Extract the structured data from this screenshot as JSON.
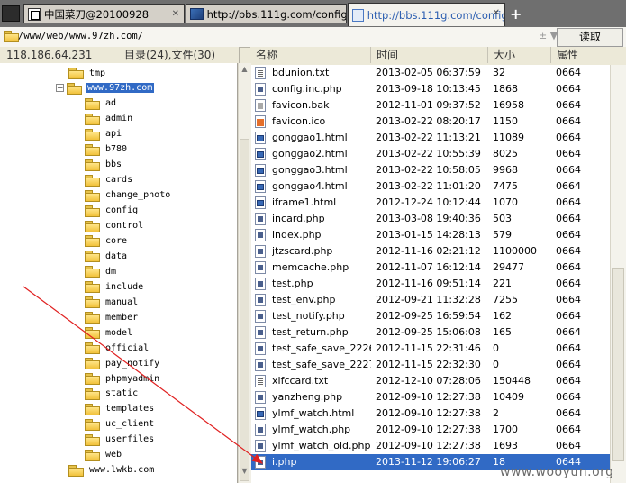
{
  "tabs": [
    {
      "label": "中国菜刀@20100928",
      "icon": "app-window-icon",
      "active": false
    },
    {
      "label": "http://bbs.111g.com/config/...",
      "icon": "image-favicon-icon",
      "active": false
    },
    {
      "label": "http://bbs.111g.com/config/...",
      "icon": "page-favicon-icon",
      "active": true
    }
  ],
  "tab_close_glyph": "✕",
  "new_tab_glyph": "+",
  "path": {
    "value": "/www/web/www.97zh.com/",
    "arrows": "± ▼",
    "button_label": "读取"
  },
  "header": {
    "ip": "118.186.64.231",
    "counts": "目录(24),文件(30)",
    "columns": {
      "name": "名称",
      "time": "时间",
      "size": "大小",
      "attr": "属性"
    }
  },
  "tree": {
    "nodes": [
      {
        "label": "tmp",
        "level": 2
      },
      {
        "label": "www.97zh.com",
        "level": 2,
        "expanded": true,
        "selected": true
      },
      {
        "label": "ad",
        "level": 3
      },
      {
        "label": "admin",
        "level": 3
      },
      {
        "label": "api",
        "level": 3
      },
      {
        "label": "b780",
        "level": 3
      },
      {
        "label": "bbs",
        "level": 3
      },
      {
        "label": "cards",
        "level": 3
      },
      {
        "label": "change_photo",
        "level": 3
      },
      {
        "label": "config",
        "level": 3
      },
      {
        "label": "control",
        "level": 3
      },
      {
        "label": "core",
        "level": 3
      },
      {
        "label": "data",
        "level": 3
      },
      {
        "label": "dm",
        "level": 3
      },
      {
        "label": "include",
        "level": 3
      },
      {
        "label": "manual",
        "level": 3
      },
      {
        "label": "member",
        "level": 3
      },
      {
        "label": "model",
        "level": 3
      },
      {
        "label": "official",
        "level": 3
      },
      {
        "label": "pay_notify",
        "level": 3
      },
      {
        "label": "phpmyadmin",
        "level": 3
      },
      {
        "label": "static",
        "level": 3
      },
      {
        "label": "templates",
        "level": 3
      },
      {
        "label": "uc_client",
        "level": 3
      },
      {
        "label": "userfiles",
        "level": 3
      },
      {
        "label": "web",
        "level": 3
      },
      {
        "label": "www.lwkb.com",
        "level": 2
      }
    ],
    "expander_glyph": "−"
  },
  "files": [
    {
      "name": "bdunion.txt",
      "time": "2013-02-05 06:37:59",
      "size": "32",
      "attr": "0664",
      "type": "txt"
    },
    {
      "name": "config.inc.php",
      "time": "2013-09-18 10:13:45",
      "size": "1868",
      "attr": "0664",
      "type": "php"
    },
    {
      "name": "favicon.bak",
      "time": "2012-11-01 09:37:52",
      "size": "16958",
      "attr": "0664",
      "type": "bak"
    },
    {
      "name": "favicon.ico",
      "time": "2013-02-22 08:20:17",
      "size": "1150",
      "attr": "0664",
      "type": "ico"
    },
    {
      "name": "gonggao1.html",
      "time": "2013-02-22 11:13:21",
      "size": "11089",
      "attr": "0664",
      "type": "html"
    },
    {
      "name": "gonggao2.html",
      "time": "2013-02-22 10:55:39",
      "size": "8025",
      "attr": "0664",
      "type": "html"
    },
    {
      "name": "gonggao3.html",
      "time": "2013-02-22 10:58:05",
      "size": "9968",
      "attr": "0664",
      "type": "html"
    },
    {
      "name": "gonggao4.html",
      "time": "2013-02-22 11:01:20",
      "size": "7475",
      "attr": "0664",
      "type": "html"
    },
    {
      "name": "iframe1.html",
      "time": "2012-12-24 10:12:44",
      "size": "1070",
      "attr": "0664",
      "type": "html"
    },
    {
      "name": "incard.php",
      "time": "2013-03-08 19:40:36",
      "size": "503",
      "attr": "0664",
      "type": "php"
    },
    {
      "name": "index.php",
      "time": "2013-01-15 14:28:13",
      "size": "579",
      "attr": "0664",
      "type": "php"
    },
    {
      "name": "jtzscard.php",
      "time": "2012-11-16 02:21:12",
      "size": "1100000",
      "attr": "0664",
      "type": "php"
    },
    {
      "name": "memcache.php",
      "time": "2012-11-07 16:12:14",
      "size": "29477",
      "attr": "0664",
      "type": "php"
    },
    {
      "name": "test.php",
      "time": "2012-11-16 09:51:14",
      "size": "221",
      "attr": "0664",
      "type": "php"
    },
    {
      "name": "test_env.php",
      "time": "2012-09-21 11:32:28",
      "size": "7255",
      "attr": "0664",
      "type": "php"
    },
    {
      "name": "test_notify.php",
      "time": "2012-09-25 16:59:54",
      "size": "162",
      "attr": "0664",
      "type": "php"
    },
    {
      "name": "test_return.php",
      "time": "2012-09-25 15:06:08",
      "size": "165",
      "attr": "0664",
      "type": "php"
    },
    {
      "name": "test_safe_save_2226...",
      "time": "2012-11-15 22:31:46",
      "size": "0",
      "attr": "0664",
      "type": "php"
    },
    {
      "name": "test_safe_save_2227...",
      "time": "2012-11-15 22:32:30",
      "size": "0",
      "attr": "0664",
      "type": "php"
    },
    {
      "name": "xlfccard.txt",
      "time": "2012-12-10 07:28:06",
      "size": "150448",
      "attr": "0664",
      "type": "txt"
    },
    {
      "name": "yanzheng.php",
      "time": "2012-09-10 12:27:38",
      "size": "10409",
      "attr": "0664",
      "type": "php"
    },
    {
      "name": "ylmf_watch.html",
      "time": "2012-09-10 12:27:38",
      "size": "2",
      "attr": "0664",
      "type": "html"
    },
    {
      "name": "ylmf_watch.php",
      "time": "2012-09-10 12:27:38",
      "size": "1700",
      "attr": "0664",
      "type": "php"
    },
    {
      "name": "ylmf_watch_old.php",
      "time": "2012-09-10 12:27:38",
      "size": "1693",
      "attr": "0664",
      "type": "php"
    },
    {
      "name": "i.php",
      "time": "2013-11-12 19:06:27",
      "size": "18",
      "attr": "0644",
      "type": "php",
      "selected": true
    }
  ],
  "watermark": "www.wooyun.org",
  "colors": {
    "selection": "#316ac5",
    "annotation_arrow": "#e02020",
    "tab_bar": "#6f6f6f"
  }
}
